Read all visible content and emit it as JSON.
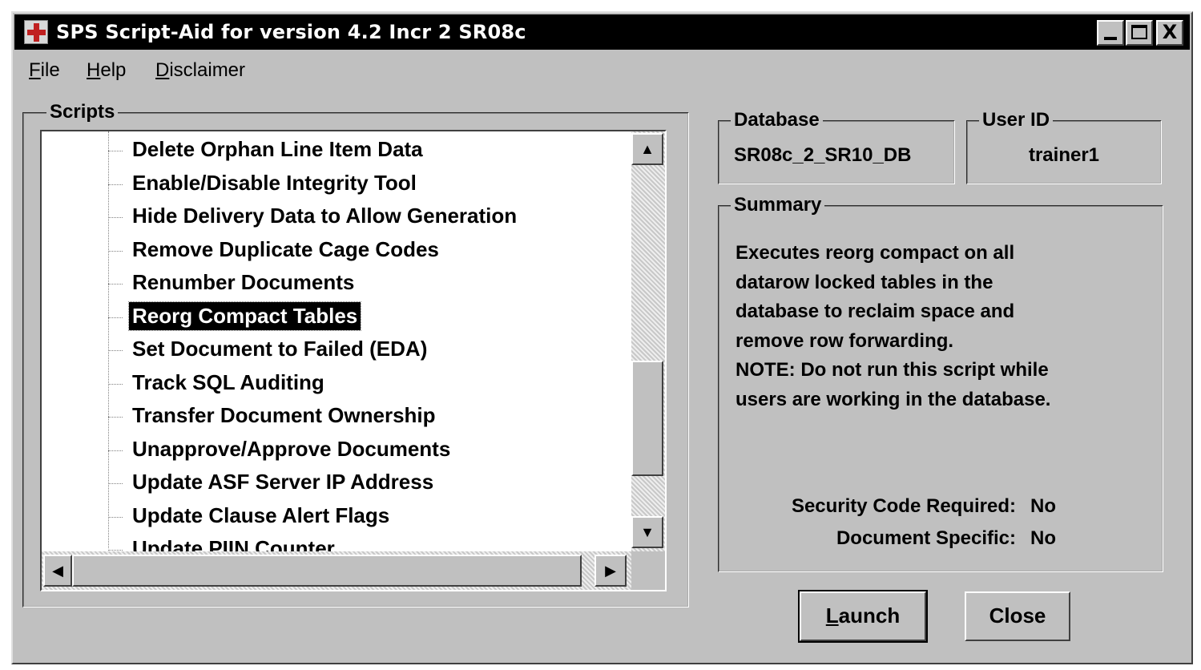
{
  "window": {
    "title": "SPS Script-Aid for version 4.2 Incr 2 SR08c",
    "controls": {
      "minimize": "_",
      "maximize": "□",
      "close": "X"
    }
  },
  "menubar": {
    "file": {
      "accel": "F",
      "rest": "ile"
    },
    "help": {
      "accel": "H",
      "rest": "elp"
    },
    "disclaimer": {
      "accel": "D",
      "rest": "isclaimer"
    }
  },
  "scripts": {
    "legend": "Scripts",
    "items": [
      "Delete Orphan Line Item Data",
      "Enable/Disable Integrity Tool",
      "Hide Delivery Data to Allow Generation",
      "Remove Duplicate Cage Codes",
      "Renumber Documents",
      "Reorg Compact Tables",
      "Set Document to Failed (EDA)",
      "Track SQL Auditing",
      "Transfer Document Ownership",
      "Unapprove/Approve Documents",
      "Update ASF Server IP Address",
      "Update Clause Alert Flags",
      "Update PIIN Counter"
    ],
    "selected_index": 5,
    "scroll_arrows": {
      "up": "▲",
      "down": "▼",
      "left": "◀",
      "right": "▶"
    }
  },
  "database": {
    "legend": "Database",
    "value": "SR08c_2_SR10_DB"
  },
  "user_id": {
    "legend": "User ID",
    "value": "trainer1"
  },
  "summary": {
    "legend": "Summary",
    "lines": [
      "Executes reorg compact on all",
      "datarow locked tables in the",
      "database to reclaim space and",
      "remove row forwarding.",
      "NOTE: Do not run this script while",
      "users are working in the database."
    ],
    "security_code_label": "Security Code Required:",
    "security_code_value": "No",
    "document_specific_label": "Document Specific:",
    "document_specific_value": "No"
  },
  "buttons": {
    "launch": {
      "accel": "L",
      "rest": "aunch"
    },
    "close": "Close"
  }
}
